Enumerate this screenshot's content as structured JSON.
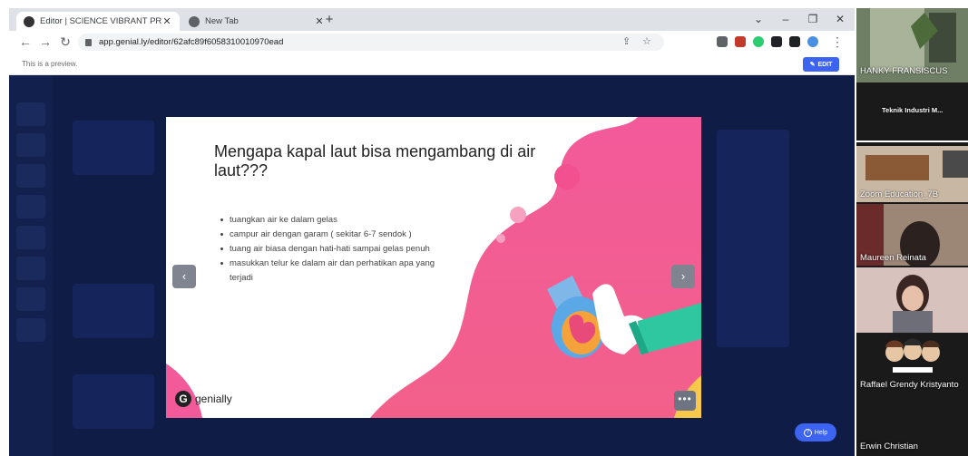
{
  "browser": {
    "tabs": [
      {
        "title": "Editor | SCIENCE VIBRANT PRESE",
        "close": "✕",
        "active": true
      },
      {
        "title": "New Tab",
        "close": "✕",
        "active": false
      }
    ],
    "new_tab": "+",
    "window_controls": {
      "chevron": "⌄",
      "minimize": "–",
      "restore": "❐",
      "close": "✕"
    },
    "url": "app.genial.ly/editor/62afc89f6058310010970ead",
    "icons": [
      "back-icon",
      "forward-icon",
      "reload-icon",
      "lock-icon",
      "share-icon",
      "star-icon",
      "extension-icon",
      "profile-icon",
      "menu-icon"
    ]
  },
  "preview": {
    "notice": "This is a preview.",
    "edit_label": "EDIT"
  },
  "slide": {
    "title": "Mengapa kapal laut bisa mengambang di air laut???",
    "bullets": [
      "tuangkan air ke dalam gelas",
      "campur air dengan garam ( sekitar 6-7 sendok )",
      "tuang air biasa dengan hati-hati sampai gelas penuh",
      "masukkan telur ke dalam air dan perhatikan apa yang terjadi"
    ],
    "logo_text": "genially",
    "more_label": "•••",
    "prev_label": "‹",
    "next_label": "›"
  },
  "help": {
    "label": "Help"
  },
  "participants": [
    {
      "name": "HANKY FRANSISCUS",
      "kind": "photo"
    },
    {
      "name": "Teknik Industri M...",
      "kind": "text"
    },
    {
      "name": "Zoom Education_7B",
      "kind": "photo"
    },
    {
      "name": "Maureen Reinata",
      "kind": "photo"
    },
    {
      "name": "",
      "kind": "photo"
    },
    {
      "name": "Raffael Grendy Kristyanto",
      "kind": "photo"
    },
    {
      "name": "Erwin Christian",
      "kind": "dark"
    }
  ],
  "colors": {
    "accent_blue": "#3d63f2",
    "stage_navy": "#0f1c45",
    "blob_pink": "#f04f8a"
  }
}
